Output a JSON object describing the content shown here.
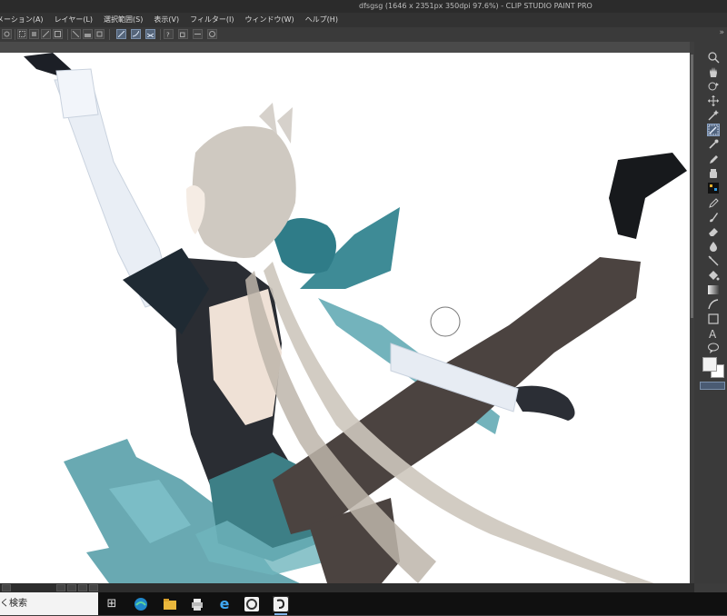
{
  "window": {
    "title": "dfsgsg (1646 x 2351px 350dpi 97.6%)  - CLIP STUDIO PAINT PRO"
  },
  "menu": {
    "items": [
      {
        "label": "メーション(A)"
      },
      {
        "label": "レイヤー(L)"
      },
      {
        "label": "選択範囲(S)"
      },
      {
        "label": "表示(V)"
      },
      {
        "label": "フィルター(I)"
      },
      {
        "label": "ウィンドウ(W)"
      },
      {
        "label": "ヘルプ(H)"
      }
    ]
  },
  "toolbar": {
    "overflow_icon": "double-chevron-right"
  },
  "tools": [
    {
      "name": "zoom-icon"
    },
    {
      "name": "hand-icon"
    },
    {
      "name": "rotate-icon"
    },
    {
      "name": "move-icon"
    },
    {
      "name": "magic-wand-icon"
    },
    {
      "name": "selection-brush-icon",
      "active": true
    },
    {
      "name": "eyedropper-icon"
    },
    {
      "name": "pen-icon"
    },
    {
      "name": "ink-bottle-icon"
    },
    {
      "name": "pattern-icon"
    },
    {
      "name": "pencil-icon"
    },
    {
      "name": "brush-icon"
    },
    {
      "name": "eraser-icon"
    },
    {
      "name": "blend-icon"
    },
    {
      "name": "line-icon"
    },
    {
      "name": "fill-icon"
    },
    {
      "name": "gradient-icon"
    },
    {
      "name": "curve-ruler-icon"
    },
    {
      "name": "rectangle-icon"
    },
    {
      "name": "text-icon"
    },
    {
      "name": "balloon-icon"
    }
  ],
  "text_tool_glyph": "A",
  "colors": {
    "main_color": "#f2f2f2",
    "sub_color": "#ffffff",
    "canvas": "#ffffff",
    "accent": "#51647f"
  },
  "taskbar": {
    "search_text": "く検索",
    "apps": [
      {
        "name": "task-view-icon",
        "glyph": "⊞"
      },
      {
        "name": "edge-icon"
      },
      {
        "name": "file-explorer-icon"
      },
      {
        "name": "printer-icon"
      },
      {
        "name": "internet-explorer-icon",
        "glyph": "e"
      },
      {
        "name": "clip-studio-launcher-icon"
      },
      {
        "name": "clip-studio-paint-icon",
        "active": true
      }
    ]
  }
}
